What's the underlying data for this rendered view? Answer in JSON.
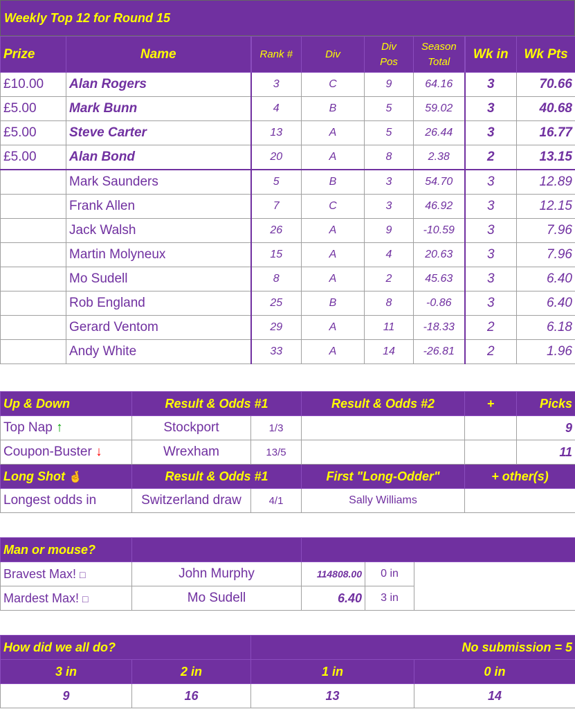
{
  "title": "Weekly Top 12 for Round 15",
  "main_table": {
    "headers": {
      "prize": "Prize",
      "name": "Name",
      "rank": "Rank #",
      "div": "Div",
      "divpos_1": "Div",
      "divpos_2": "Pos",
      "season_1": "Season",
      "season_2": "Total",
      "wkin": "Wk in",
      "wkpts": "Wk Pts"
    },
    "rows": [
      {
        "prize": "£10.00",
        "name": "Alan Rogers",
        "rank": "3",
        "div": "C",
        "divpos": "9",
        "season": "64.16",
        "wkin": "3",
        "wkpts": "70.66"
      },
      {
        "prize": "£5.00",
        "name": "Mark Bunn",
        "rank": "4",
        "div": "B",
        "divpos": "5",
        "season": "59.02",
        "wkin": "3",
        "wkpts": "40.68"
      },
      {
        "prize": "£5.00",
        "name": "Steve Carter",
        "rank": "13",
        "div": "A",
        "divpos": "5",
        "season": "26.44",
        "wkin": "3",
        "wkpts": "16.77"
      },
      {
        "prize": "£5.00",
        "name": "Alan Bond",
        "rank": "20",
        "div": "A",
        "divpos": "8",
        "season": "2.38",
        "wkin": "2",
        "wkpts": "13.15"
      },
      {
        "prize": "",
        "name": "Mark Saunders",
        "rank": "5",
        "div": "B",
        "divpos": "3",
        "season": "54.70",
        "wkin": "3",
        "wkpts": "12.89"
      },
      {
        "prize": "",
        "name": "Frank Allen",
        "rank": "7",
        "div": "C",
        "divpos": "3",
        "season": "46.92",
        "wkin": "3",
        "wkpts": "12.15"
      },
      {
        "prize": "",
        "name": "Jack Walsh",
        "rank": "26",
        "div": "A",
        "divpos": "9",
        "season": "-10.59",
        "wkin": "3",
        "wkpts": "7.96"
      },
      {
        "prize": "",
        "name": "Martin Molyneux",
        "rank": "15",
        "div": "A",
        "divpos": "4",
        "season": "20.63",
        "wkin": "3",
        "wkpts": "7.96"
      },
      {
        "prize": "",
        "name": "Mo Sudell",
        "rank": "8",
        "div": "A",
        "divpos": "2",
        "season": "45.63",
        "wkin": "3",
        "wkpts": "6.40"
      },
      {
        "prize": "",
        "name": "Rob England",
        "rank": "25",
        "div": "B",
        "divpos": "8",
        "season": "-0.86",
        "wkin": "3",
        "wkpts": "6.40"
      },
      {
        "prize": "",
        "name": "Gerard Ventom",
        "rank": "29",
        "div": "A",
        "divpos": "11",
        "season": "-18.33",
        "wkin": "2",
        "wkpts": "6.18"
      },
      {
        "prize": "",
        "name": "Andy White",
        "rank": "33",
        "div": "A",
        "divpos": "14",
        "season": "-26.81",
        "wkin": "2",
        "wkpts": "1.96"
      }
    ]
  },
  "updown": {
    "headers": {
      "col1": "Up & Down",
      "col2": "Result & Odds #1",
      "col3": "Result & Odds #2",
      "col4": "+",
      "col5": "Picks"
    },
    "top_nap": {
      "label": "Top Nap",
      "icon": "up-arrow-icon",
      "icon_char": "↑",
      "icon_color": "#00a000",
      "team": "Stockport",
      "odds": "1/3",
      "picks": "9"
    },
    "coupon_buster": {
      "label": "Coupon-Buster",
      "icon": "down-arrow-icon",
      "icon_char": "↓",
      "icon_color": "#ff0000",
      "team": "Wrexham",
      "odds": "13/5",
      "picks": "11"
    },
    "long_shot_headers": {
      "col1": "Long Shot",
      "icon": "crossed-fingers-icon",
      "icon_char": "🤞",
      "col2": "Result & Odds #1",
      "col3": "First \"Long-Odder\"",
      "col4": "+ other(s)"
    },
    "longest": {
      "label": "Longest odds in",
      "team": "Switzerland draw",
      "odds": "4/1",
      "first": "Sally Williams",
      "other": ""
    }
  },
  "man_or_mouse": {
    "header": "Man or mouse?",
    "bravest": {
      "label": "Bravest Max!",
      "glyph": "□",
      "name": "John Murphy",
      "value": "114808.00",
      "in": "0 in"
    },
    "mardest": {
      "label": "Mardest Max!",
      "glyph": "□",
      "name": "Mo Sudell",
      "value": "6.40",
      "in": "3 in"
    }
  },
  "how_did": {
    "title": "How did we all do?",
    "no_submission": "No submission = 5",
    "cols": [
      "3 in",
      "2 in",
      "1 in",
      "0 in"
    ],
    "values": [
      "9",
      "16",
      "13",
      "14"
    ]
  },
  "colors": {
    "header_bg": "#7030a0",
    "header_text": "#ffff00",
    "body_text": "#7030a0"
  }
}
